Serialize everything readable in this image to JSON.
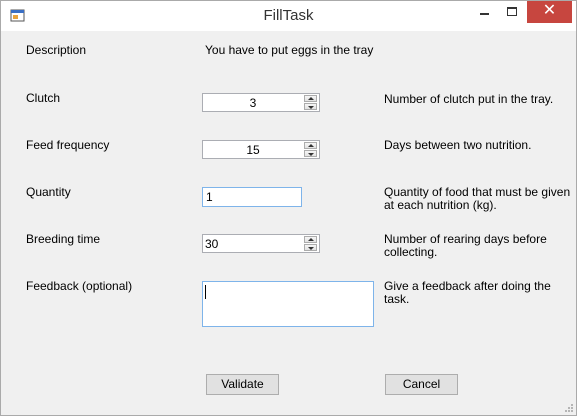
{
  "window": {
    "title": "FillTask",
    "controls": {
      "minimize": "minimize-icon",
      "maximize": "maximize-icon",
      "close": "close-icon",
      "close_color": "#c7463f"
    }
  },
  "description": {
    "label": "Description",
    "text": "You have to put eggs in the tray"
  },
  "clutch": {
    "label": "Clutch",
    "value": "3",
    "help": "Number of clutch put in the tray."
  },
  "feed_frequency": {
    "label": "Feed frequency",
    "value": "15",
    "help": "Days between two nutrition."
  },
  "quantity": {
    "label": "Quantity",
    "value": "1",
    "help_line1": "Quantity of food that must be given",
    "help_line2": "at each nutrition (kg)."
  },
  "breeding_time": {
    "label": "Breeding time",
    "value": "30",
    "help_line1": "Number of rearing days before",
    "help_line2": "collecting."
  },
  "feedback": {
    "label": "Feedback (optional)",
    "value": "",
    "help_line1": "Give a feedback after doing the",
    "help_line2": "task."
  },
  "buttons": {
    "validate": "Validate",
    "cancel": "Cancel"
  }
}
